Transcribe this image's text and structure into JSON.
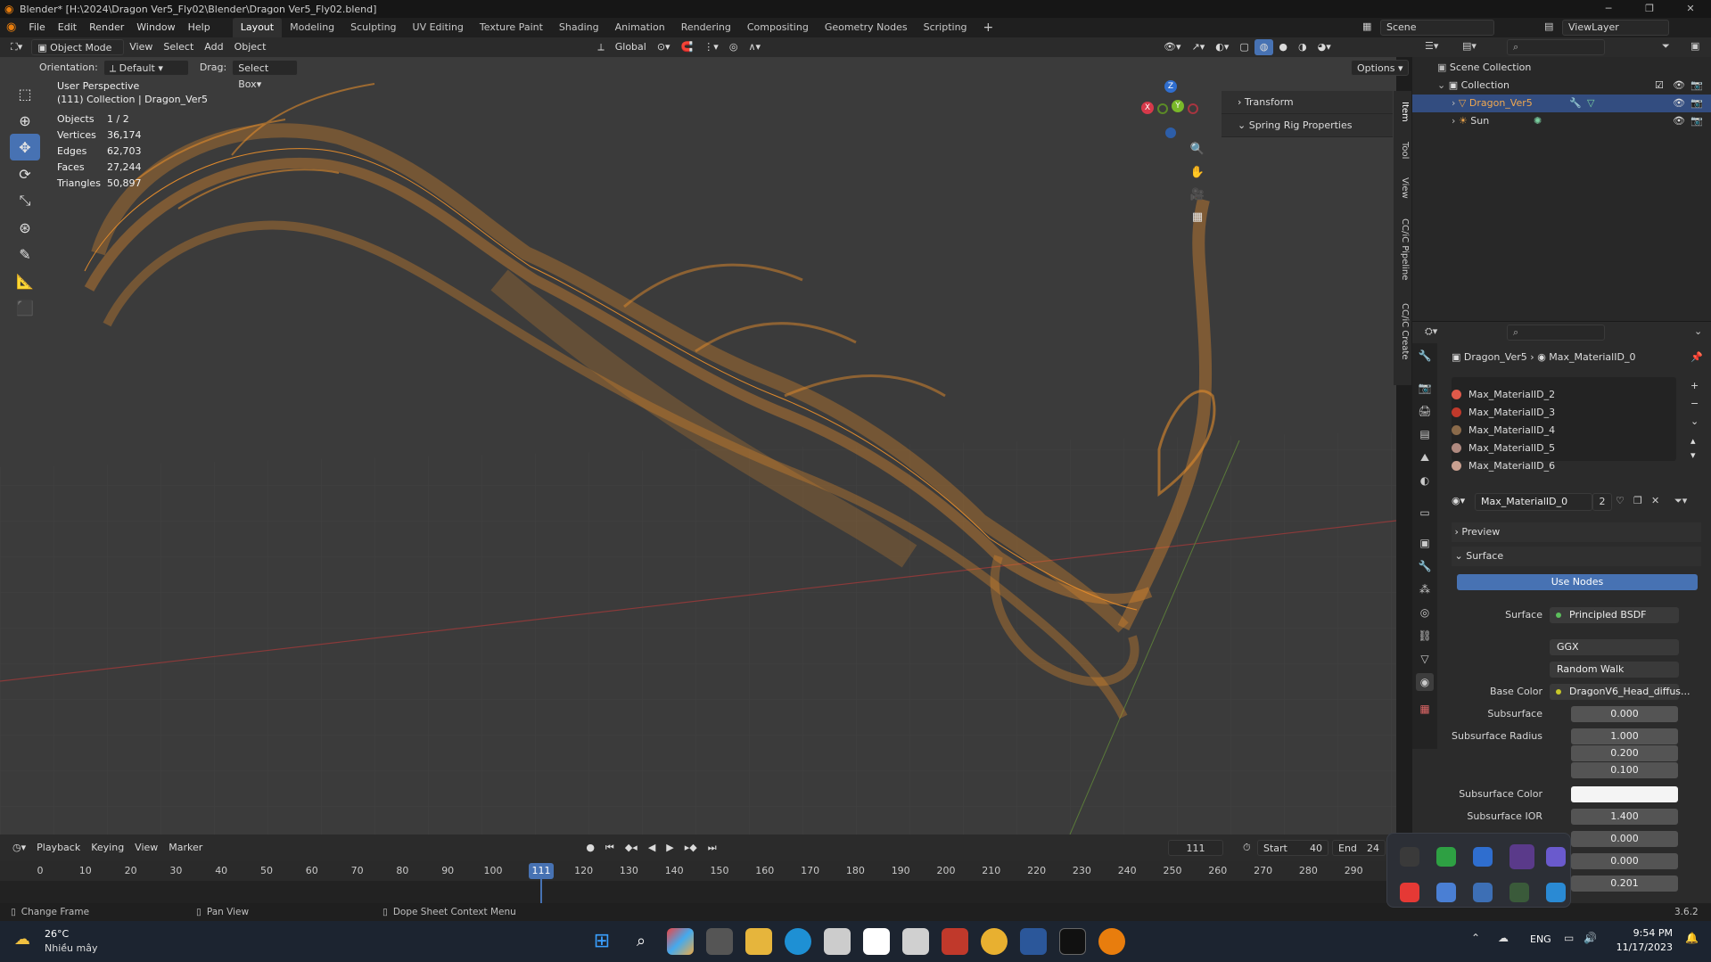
{
  "window": {
    "title": "Blender* [H:\\2024\\Dragon Ver5_Fly02\\Blender\\Dragon Ver5_Fly02.blend]"
  },
  "menu": [
    "File",
    "Edit",
    "Render",
    "Window",
    "Help"
  ],
  "workspaces": [
    "Layout",
    "Modeling",
    "Sculpting",
    "UV Editing",
    "Texture Paint",
    "Shading",
    "Animation",
    "Rendering",
    "Compositing",
    "Geometry Nodes",
    "Scripting"
  ],
  "scene": {
    "name": "Scene",
    "viewlayer": "ViewLayer"
  },
  "viewport_header": {
    "mode": "Object Mode",
    "view": "View",
    "select": "Select",
    "add": "Add",
    "object": "Object",
    "transform_orientation": "Global"
  },
  "viewport_sub": {
    "orientation_label": "Orientation:",
    "orientation": "Default",
    "drag_label": "Drag:",
    "drag": "Select Box",
    "options": "Options"
  },
  "overlay": {
    "line1": "User Perspective",
    "line2": "(111) Collection | Dragon_Ver5",
    "stats": [
      {
        "k": "Objects",
        "v": "1 / 2"
      },
      {
        "k": "Vertices",
        "v": "36,174"
      },
      {
        "k": "Edges",
        "v": "62,703"
      },
      {
        "k": "Faces",
        "v": "27,244"
      },
      {
        "k": "Triangles",
        "v": "50,897"
      }
    ]
  },
  "npanel": {
    "items": [
      "Transform",
      "Spring Rig Properties"
    ],
    "tabs": [
      "Item",
      "Tool",
      "View",
      "CC/iC Pipeline",
      "CC/iC Create"
    ]
  },
  "gizmo": {
    "x": "X",
    "y": "Y",
    "z": "Z"
  },
  "outliner": {
    "root": "Scene Collection",
    "collection": "Collection",
    "items": [
      {
        "name": "Dragon_Ver5"
      },
      {
        "name": "Sun"
      }
    ]
  },
  "properties": {
    "breadcrumb_object": "Dragon_Ver5",
    "breadcrumb_material": "Max_MaterialID_0",
    "materials": [
      {
        "name": "Max_MaterialID_2",
        "color": "#e05a4a"
      },
      {
        "name": "Max_MaterialID_3",
        "color": "#c0392b"
      },
      {
        "name": "Max_MaterialID_4",
        "color": "#8a6a4a"
      },
      {
        "name": "Max_MaterialID_5",
        "color": "#b08a80"
      },
      {
        "name": "Max_MaterialID_6",
        "color": "#c9a090"
      }
    ],
    "active_material": "Max_MaterialID_0",
    "users": "2",
    "preview": "Preview",
    "surface_section": "Surface",
    "use_nodes": "Use Nodes",
    "surface_label": "Surface",
    "surface_value": "Principled BSDF",
    "distribution": "GGX",
    "subsurface_method": "Random Walk",
    "fields": [
      {
        "label": "Base Color",
        "value": "DragonV6_Head_diffus..."
      },
      {
        "label": "Subsurface",
        "value": "0.000"
      },
      {
        "label": "Subsurface Radius",
        "value": "1.000"
      },
      {
        "label": "",
        "value": "0.200"
      },
      {
        "label": "",
        "value": "0.100"
      },
      {
        "label": "Subsurface Color",
        "value": ""
      },
      {
        "label": "Subsurface IOR",
        "value": "1.400"
      },
      {
        "label": "",
        "value": "0.000"
      },
      {
        "label": "",
        "value": "0.000"
      },
      {
        "label": "",
        "value": "0.201"
      }
    ]
  },
  "timeline": {
    "playback": "Playback",
    "keying": "Keying",
    "view": "View",
    "marker": "Marker",
    "current_frame": "111",
    "start_label": "Start",
    "start": "40",
    "end_label": "End",
    "end": "24",
    "ticks": [
      "0",
      "10",
      "20",
      "30",
      "40",
      "50",
      "60",
      "70",
      "80",
      "90",
      "100",
      "110",
      "120",
      "130",
      "140",
      "150",
      "160",
      "170",
      "180",
      "190",
      "200",
      "210",
      "220",
      "230",
      "240",
      "250",
      "260",
      "270",
      "280",
      "290"
    ]
  },
  "statusbar": {
    "a": "Change Frame",
    "b": "Pan View",
    "c": "Dope Sheet Context Menu",
    "version": "3.6.2"
  },
  "taskbar": {
    "temp": "26°C",
    "weather": "Nhiều mây",
    "lang": "ENG",
    "time": "9:54 PM",
    "date": "11/17/2023"
  },
  "colors": {
    "accent": "#4772b3",
    "wire": "#e08a2c",
    "viewport": "#3b3b3b"
  }
}
